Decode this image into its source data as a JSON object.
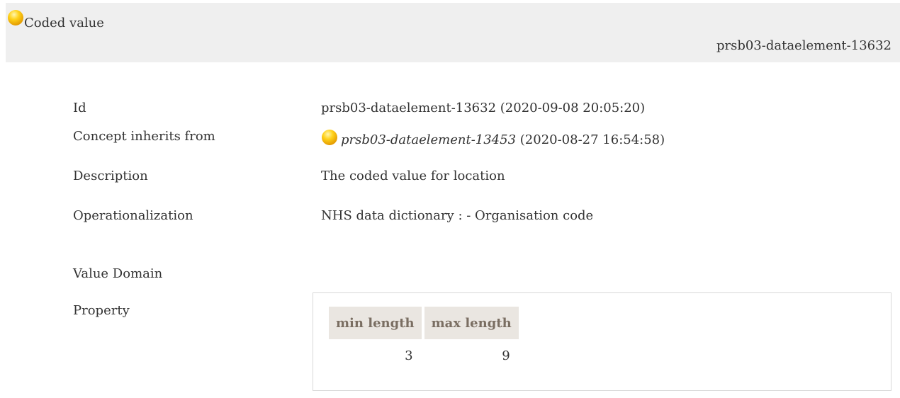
{
  "header": {
    "title": "Coded value",
    "id": "prsb03-dataelement-13632",
    "status_icon": "yellow-status-ball-icon"
  },
  "details": {
    "id": {
      "label": "Id",
      "value": "prsb03-dataelement-13632 (2020-09-08 20:05:20)"
    },
    "inherits": {
      "label": "Concept inherits from",
      "link": "prsb03-dataelement-13453",
      "suffix": " (2020-08-27 16:54:58)",
      "icon": "yellow-status-ball-icon"
    },
    "description": {
      "label": "Description",
      "value": "The coded value for location"
    },
    "operationalization": {
      "label": "Operationalization",
      "value": "NHS data dictionary : - Organisation code"
    },
    "value_domain": {
      "label": "Value Domain"
    },
    "property": {
      "label": "Property",
      "columns": [
        "min length",
        "max length"
      ],
      "values": [
        "3",
        "9"
      ]
    }
  },
  "colors": {
    "header_bg": "#efefef",
    "table_header_bg": "#eae6e1",
    "table_header_text": "#7a6e62",
    "status_ball": "#f5c400"
  }
}
